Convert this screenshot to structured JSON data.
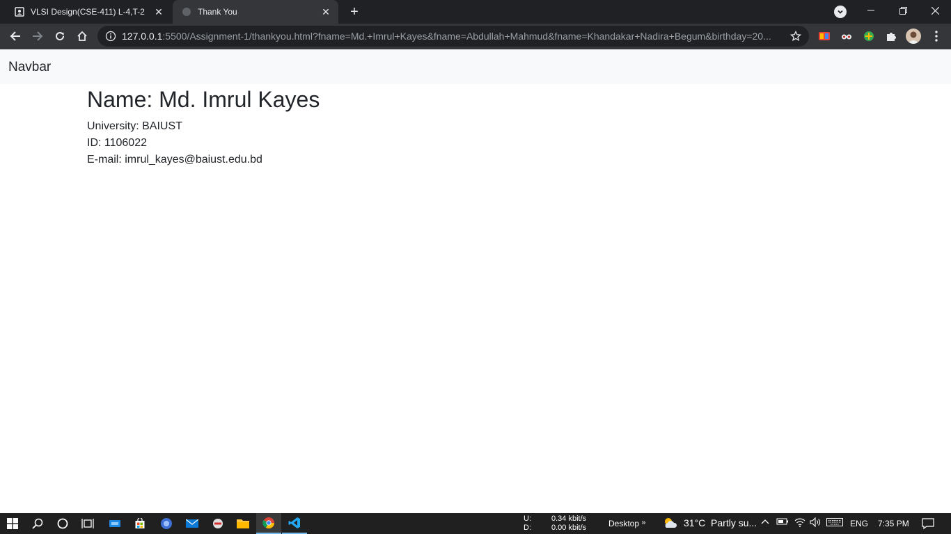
{
  "browser": {
    "tabs": [
      {
        "title": "VLSI Design(CSE-411) L-4,T-2",
        "active": false
      },
      {
        "title": "Thank You",
        "active": true
      }
    ],
    "url_host": "127.0.0.1",
    "url_rest": ":5500/Assignment-1/thankyou.html?fname=Md.+Imrul+Kayes&fname=Abdullah+Mahmud&fname=Khandakar+Nadira+Begum&birthday=20..."
  },
  "page": {
    "navbar_brand": "Navbar",
    "name_heading": "Name: Md. Imrul Kayes",
    "university": "University: BAIUST",
    "id": "ID: 1106022",
    "email": "E-mail: imrul_kayes@baiust.edu.bd"
  },
  "taskbar": {
    "net_up_label": "U:",
    "net_down_label": "D:",
    "net_up_value": "0.34 kbit/s",
    "net_down_value": "0.00 kbit/s",
    "desktop_label": "Desktop",
    "weather": "31°C  Partly su...",
    "language": "ENG",
    "time": "7:35 PM"
  }
}
